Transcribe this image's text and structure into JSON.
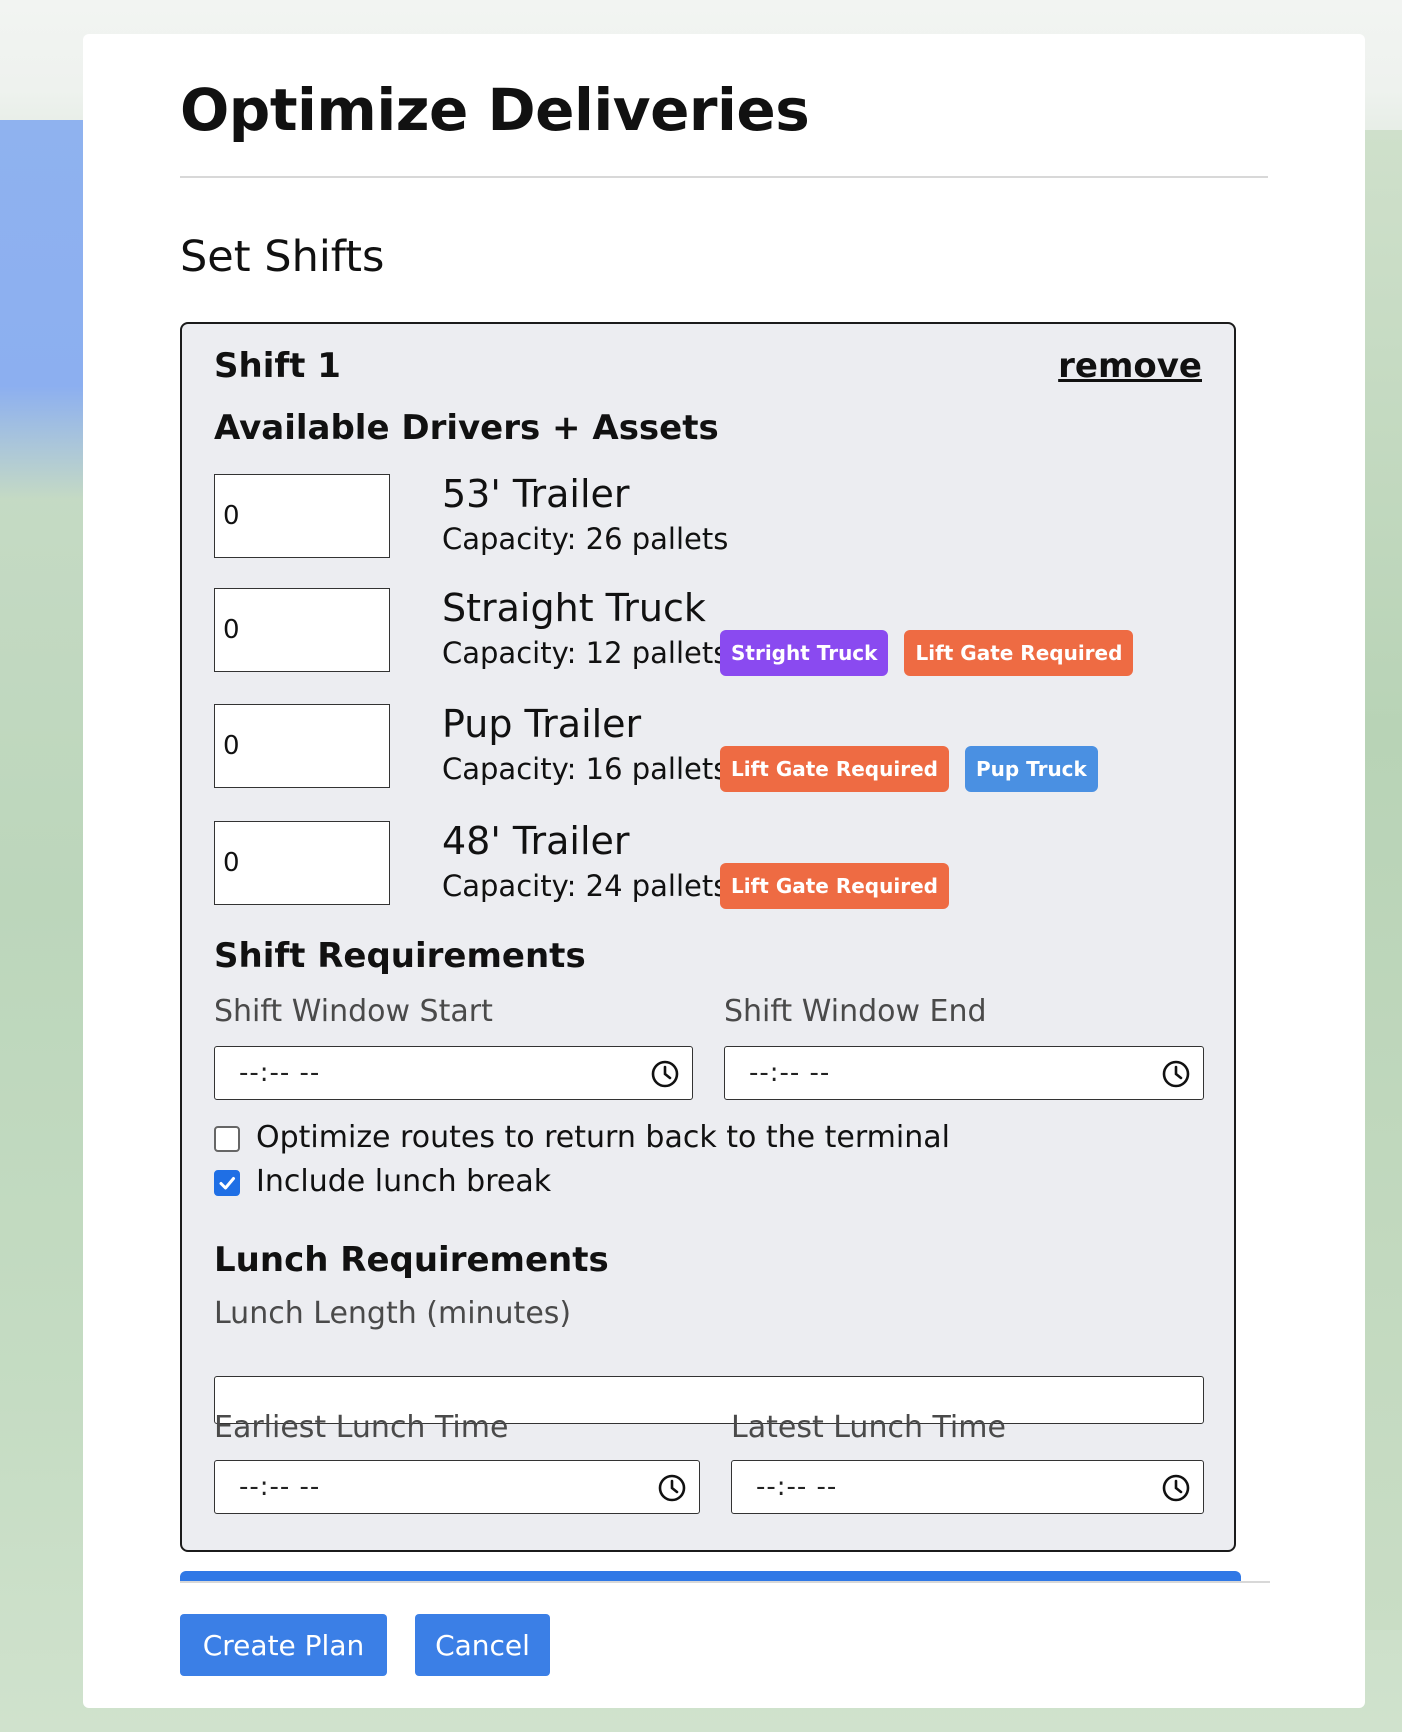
{
  "modal": {
    "title": "Optimize Deliveries",
    "section_title": "Set Shifts"
  },
  "shift": {
    "name": "Shift 1",
    "remove_label": "remove",
    "assets_heading": "Available Drivers + Assets",
    "assets": [
      {
        "count": "0",
        "name": "53' Trailer",
        "capacity": "Capacity: 26 pallets",
        "tags": []
      },
      {
        "count": "0",
        "name": "Straight Truck",
        "capacity": "Capacity: 12 pallets",
        "tags": [
          {
            "label": "Stright Truck",
            "color": "#8a4af0"
          },
          {
            "label": "Lift Gate Required",
            "color": "#ee6b43"
          }
        ]
      },
      {
        "count": "0",
        "name": "Pup Trailer",
        "capacity": "Capacity: 16 pallets",
        "tags": [
          {
            "label": "Lift Gate Required",
            "color": "#ee6b43"
          },
          {
            "label": "Pup Truck",
            "color": "#4a90e2"
          }
        ]
      },
      {
        "count": "0",
        "name": "48' Trailer",
        "capacity": "Capacity: 24 pallets",
        "tags": [
          {
            "label": "Lift Gate Required",
            "color": "#ee6b43"
          }
        ]
      }
    ],
    "requirements_heading": "Shift Requirements",
    "window_start_label": "Shift Window Start",
    "window_end_label": "Shift Window End",
    "window_start_value": "--:-- --",
    "window_end_value": "--:-- --",
    "return_to_terminal_label": "Optimize routes to return back to the terminal",
    "return_to_terminal_checked": false,
    "include_lunch_label": "Include lunch break",
    "include_lunch_checked": true,
    "lunch_heading": "Lunch Requirements",
    "lunch_length_label": "Lunch Length (minutes)",
    "lunch_length_value": "",
    "earliest_lunch_label": "Earliest Lunch Time",
    "latest_lunch_label": "Latest Lunch Time",
    "earliest_lunch_value": "--:-- --",
    "latest_lunch_value": "--:-- --"
  },
  "footer": {
    "create_label": "Create Plan",
    "cancel_label": "Cancel"
  },
  "colors": {
    "primary": "#3b7fe6",
    "purple_tag": "#8a4af0",
    "orange_tag": "#ee6b43",
    "blue_tag": "#4a90e2"
  }
}
